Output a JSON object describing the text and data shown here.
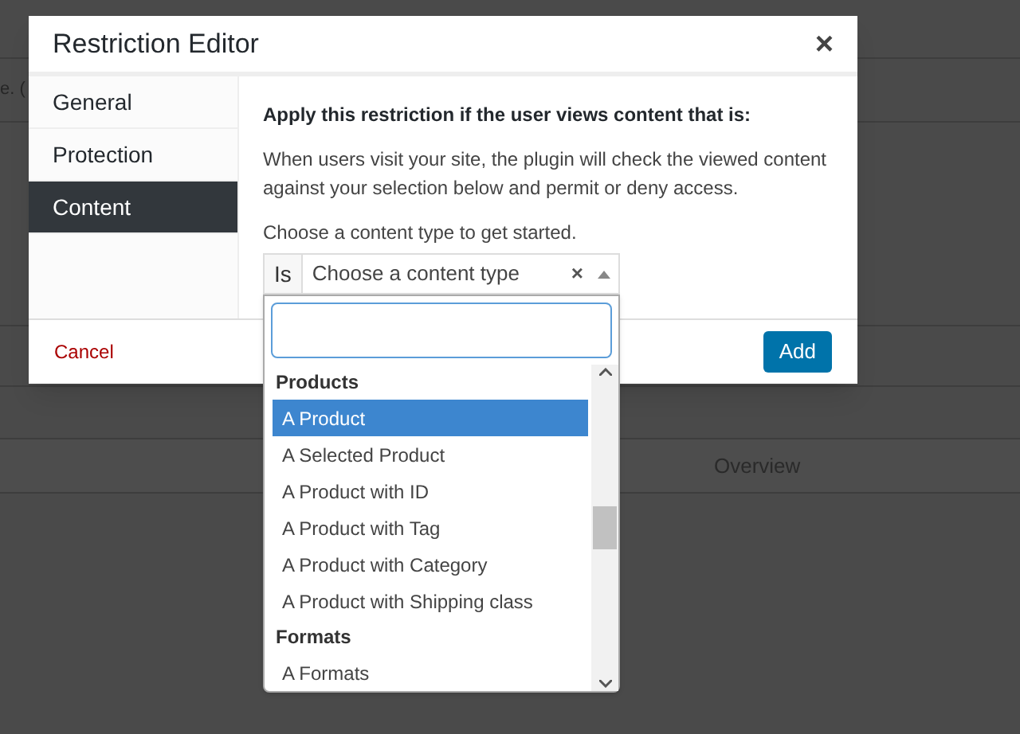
{
  "background": {
    "row_text": "e. (",
    "column_text": "Overview"
  },
  "dialog": {
    "title": "Restriction Editor",
    "close": "×",
    "tabs": [
      {
        "label": "General",
        "selected": false
      },
      {
        "label": "Protection",
        "selected": false
      },
      {
        "label": "Content",
        "selected": true
      }
    ],
    "heading": "Apply this restriction if the user views content that is:",
    "description": "When users visit your site, the plugin will check the viewed content against your selection below and permit or deny access.",
    "prompt": "Choose a content type to get started.",
    "select": {
      "prefix": "Is",
      "placeholder": "Choose a content type",
      "clear": "×",
      "expanded": true
    },
    "cancel": "Cancel",
    "add": "Add"
  },
  "dropdown": {
    "groups": [
      {
        "label": "Products",
        "options": [
          {
            "label": "A Product",
            "selected": true
          },
          {
            "label": "A Selected Product",
            "selected": false
          },
          {
            "label": "A Product with ID",
            "selected": false
          },
          {
            "label": "A Product with Tag",
            "selected": false
          },
          {
            "label": "A Product with Category",
            "selected": false
          },
          {
            "label": "A Product with Shipping class",
            "selected": false
          }
        ]
      },
      {
        "label": "Formats",
        "options": [
          {
            "label": "A Formats",
            "selected": false
          }
        ]
      }
    ]
  }
}
